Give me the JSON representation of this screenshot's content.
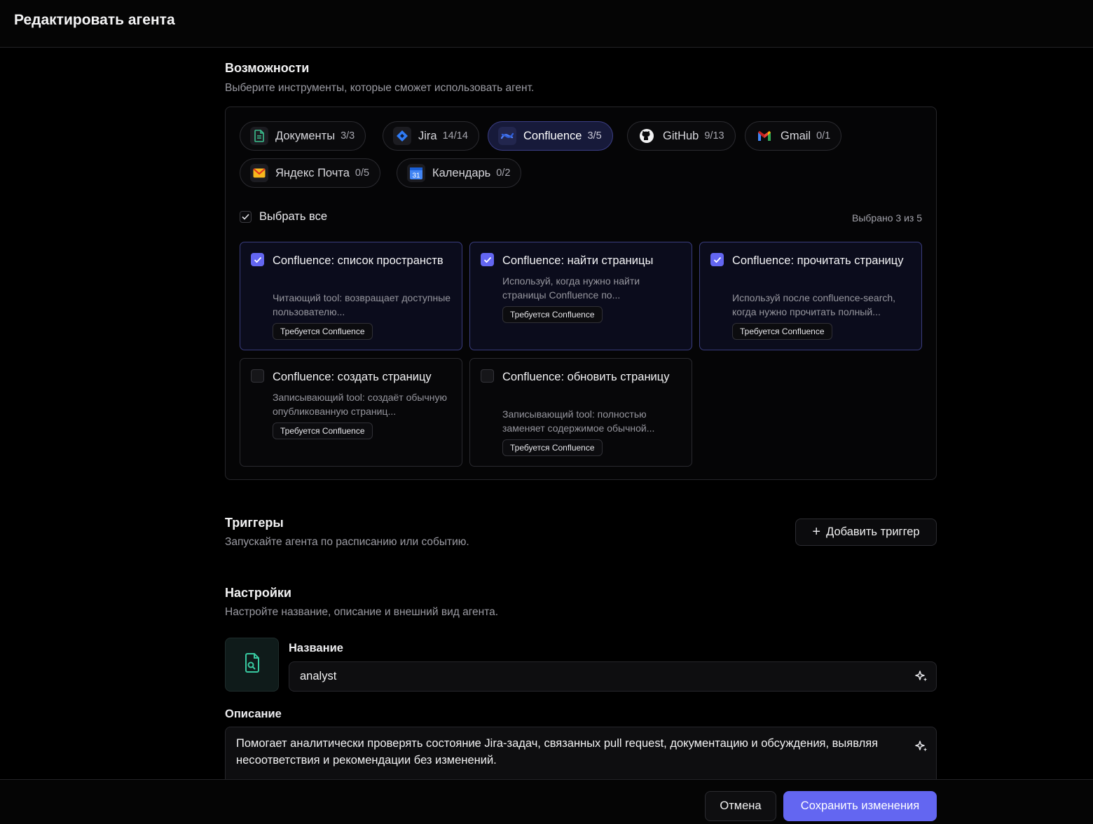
{
  "header": {
    "title": "Редактировать агента"
  },
  "capabilities": {
    "title": "Возможности",
    "subtitle": "Выберите инструменты, которые сможет использовать агент.",
    "tabs": [
      {
        "label": "Документы",
        "count": "3/3",
        "icon": "document-icon",
        "active": false
      },
      {
        "label": "Jira",
        "count": "14/14",
        "icon": "jira-icon",
        "active": false
      },
      {
        "label": "Confluence",
        "count": "3/5",
        "icon": "confluence-icon",
        "active": true
      },
      {
        "label": "GitHub",
        "count": "9/13",
        "icon": "github-icon",
        "active": false
      },
      {
        "label": "Gmail",
        "count": "0/1",
        "icon": "gmail-icon",
        "active": false
      },
      {
        "label": "Яндекс Почта",
        "count": "0/5",
        "icon": "yandex-mail-icon",
        "active": false
      },
      {
        "label": "Календарь",
        "count": "0/2",
        "icon": "calendar-icon",
        "active": false
      }
    ],
    "select_all_label": "Выбрать все",
    "selected_count": "Выбрано 3 из 5",
    "tools": [
      {
        "title": "Confluence: список пространств",
        "desc": "Читающий tool: возвращает доступные пользователю...",
        "badge": "Требуется Confluence",
        "checked": true
      },
      {
        "title": "Confluence: найти страницы",
        "desc": "Используй, когда нужно найти страницы Confluence по...",
        "badge": "Требуется Confluence",
        "checked": true
      },
      {
        "title": "Confluence: прочитать страницу",
        "desc": "Используй после confluence-search, когда нужно прочитать полный...",
        "badge": "Требуется Confluence",
        "checked": true
      },
      {
        "title": "Confluence: создать страницу",
        "desc": "Записывающий tool: создаёт обычную опубликованную страниц...",
        "badge": "Требуется Confluence",
        "checked": false
      },
      {
        "title": "Confluence: обновить страницу",
        "desc": "Записывающий tool: полностью заменяет содержимое обычной...",
        "badge": "Требуется Confluence",
        "checked": false
      }
    ]
  },
  "triggers": {
    "title": "Триггеры",
    "subtitle": "Запускайте агента по расписанию или событию.",
    "add_button": "Добавить триггер"
  },
  "settings": {
    "title": "Настройки",
    "subtitle": "Настройте название, описание и внешний вид агента.",
    "name_label": "Название",
    "name_value": "analyst",
    "description_label": "Описание",
    "description_value": "Помогает аналитически проверять состояние Jira-задач, связанных pull request, документацию и обсуждения, выявляя несоответствия и рекомендации без изменений."
  },
  "footer": {
    "cancel": "Отмена",
    "save": "Сохранить изменения"
  },
  "colors": {
    "accent": "#6366f1",
    "background": "#000000"
  }
}
